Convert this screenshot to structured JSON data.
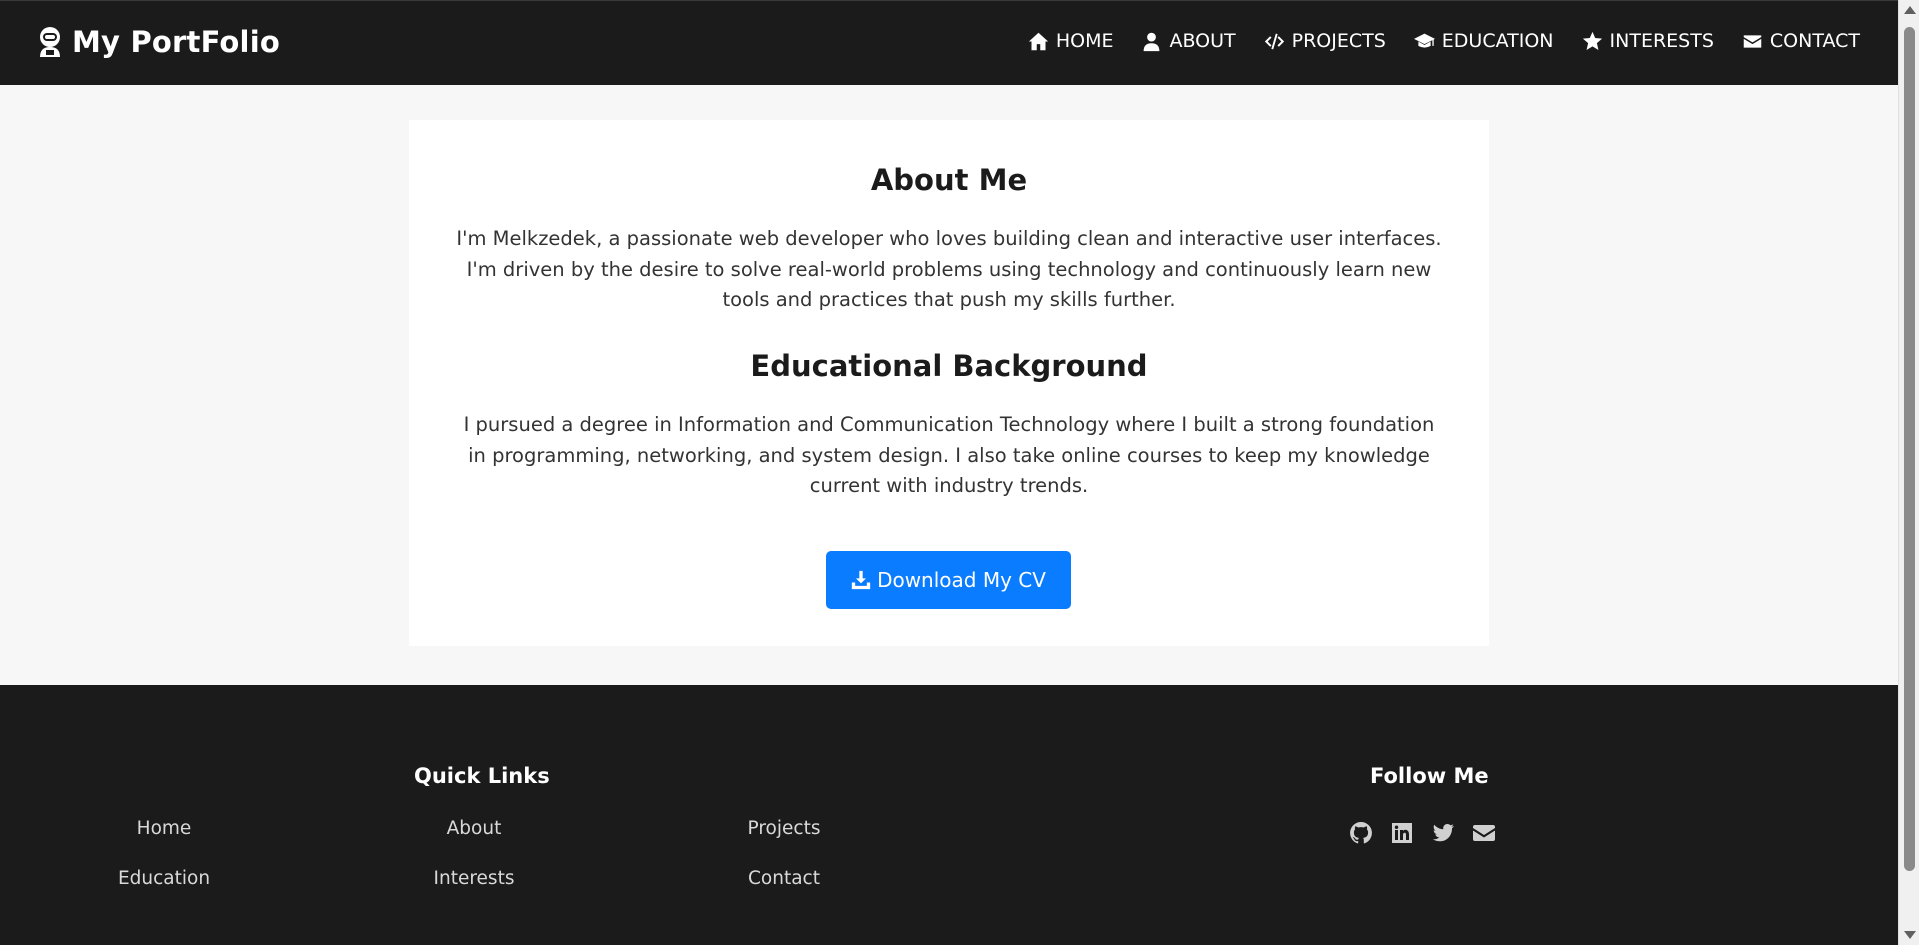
{
  "brand": {
    "name": "My PortFolio",
    "icon": "astronaut-icon"
  },
  "nav": {
    "items": [
      {
        "label": "HOME",
        "icon": "home-icon"
      },
      {
        "label": "ABOUT",
        "icon": "user-icon"
      },
      {
        "label": "PROJECTS",
        "icon": "code-icon"
      },
      {
        "label": "EDUCATION",
        "icon": "graduation-cap-icon"
      },
      {
        "label": "INTERESTS",
        "icon": "star-icon"
      },
      {
        "label": "CONTACT",
        "icon": "envelope-icon"
      }
    ]
  },
  "about": {
    "title": "About Me",
    "text": "I'm Melkzedek, a passionate web developer who loves building clean and interactive user interfaces. I'm driven by the desire to solve real-world problems using technology and continuously learn new tools and practices that push my skills further."
  },
  "education": {
    "title": "Educational Background",
    "text": "I pursued a degree in Information and Communication Technology where I built a strong foundation in programming, networking, and system design. I also take online courses to keep my knowledge current with industry trends."
  },
  "cv_button": {
    "label": "Download My CV",
    "icon": "download-icon"
  },
  "footer": {
    "quick_links_title": "Quick Links",
    "links": [
      "Home",
      "About",
      "Projects",
      "Education",
      "Interests",
      "Contact"
    ],
    "follow_title": "Follow Me",
    "social": [
      "github-icon",
      "linkedin-icon",
      "twitter-icon",
      "envelope-icon"
    ]
  },
  "colors": {
    "nav_bg": "#1b1b1b",
    "page_bg": "#f7f7f7",
    "card_bg": "#ffffff",
    "accent": "#0a7cff"
  }
}
